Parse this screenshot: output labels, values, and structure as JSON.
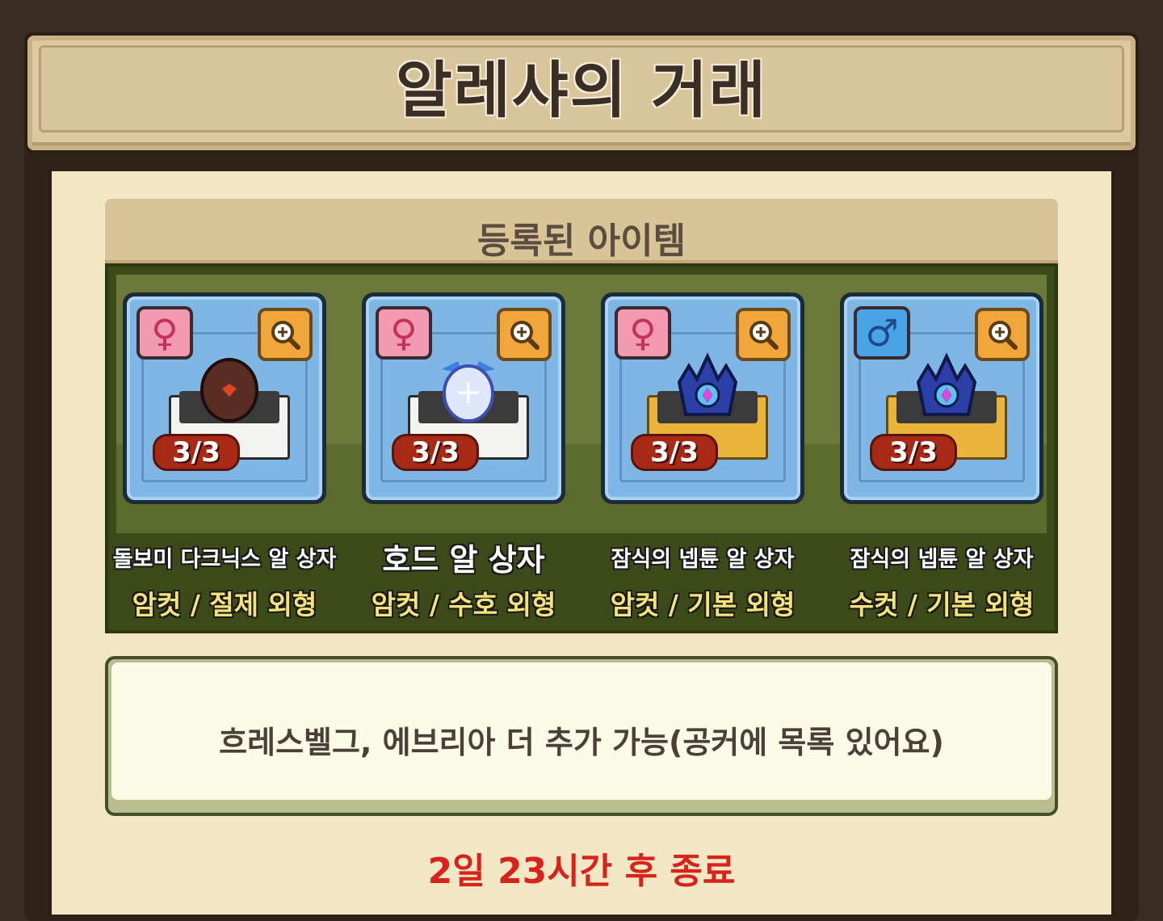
{
  "title": "알레샤의 거래",
  "section_title": "등록된 아이템",
  "items": [
    {
      "name": "돌보미 다크닉스 알 상자",
      "type": "암컷 / 절제 외형",
      "gender": "female",
      "gender_symbol": "♀",
      "count": "3/3",
      "egg_color": "#5a2d22",
      "box_style": "white"
    },
    {
      "name": "호드 알 상자",
      "type": "암컷 / 수호 외형",
      "gender": "female",
      "gender_symbol": "♀",
      "count": "3/3",
      "egg_color": "#dfe8fb",
      "box_style": "white"
    },
    {
      "name": "잠식의 넵튠 알 상자",
      "type": "암컷 / 기본 외형",
      "gender": "female",
      "gender_symbol": "♀",
      "count": "3/3",
      "egg_color": "#3d6fd1",
      "box_style": "gold"
    },
    {
      "name": "잠식의 넵튠 알 상자",
      "type": "수컷 / 기본 외형",
      "gender": "male",
      "gender_symbol": "♂",
      "count": "3/3",
      "egg_color": "#3d6fd1",
      "box_style": "gold"
    }
  ],
  "note": "흐레스벨그, 에브리아 더 추가 가능(공커에 목록 있어요)",
  "end_notice": "2일 23시간 후 종료",
  "icons": {
    "zoom": "zoom-in-icon",
    "female": "female-icon",
    "male": "male-icon"
  }
}
